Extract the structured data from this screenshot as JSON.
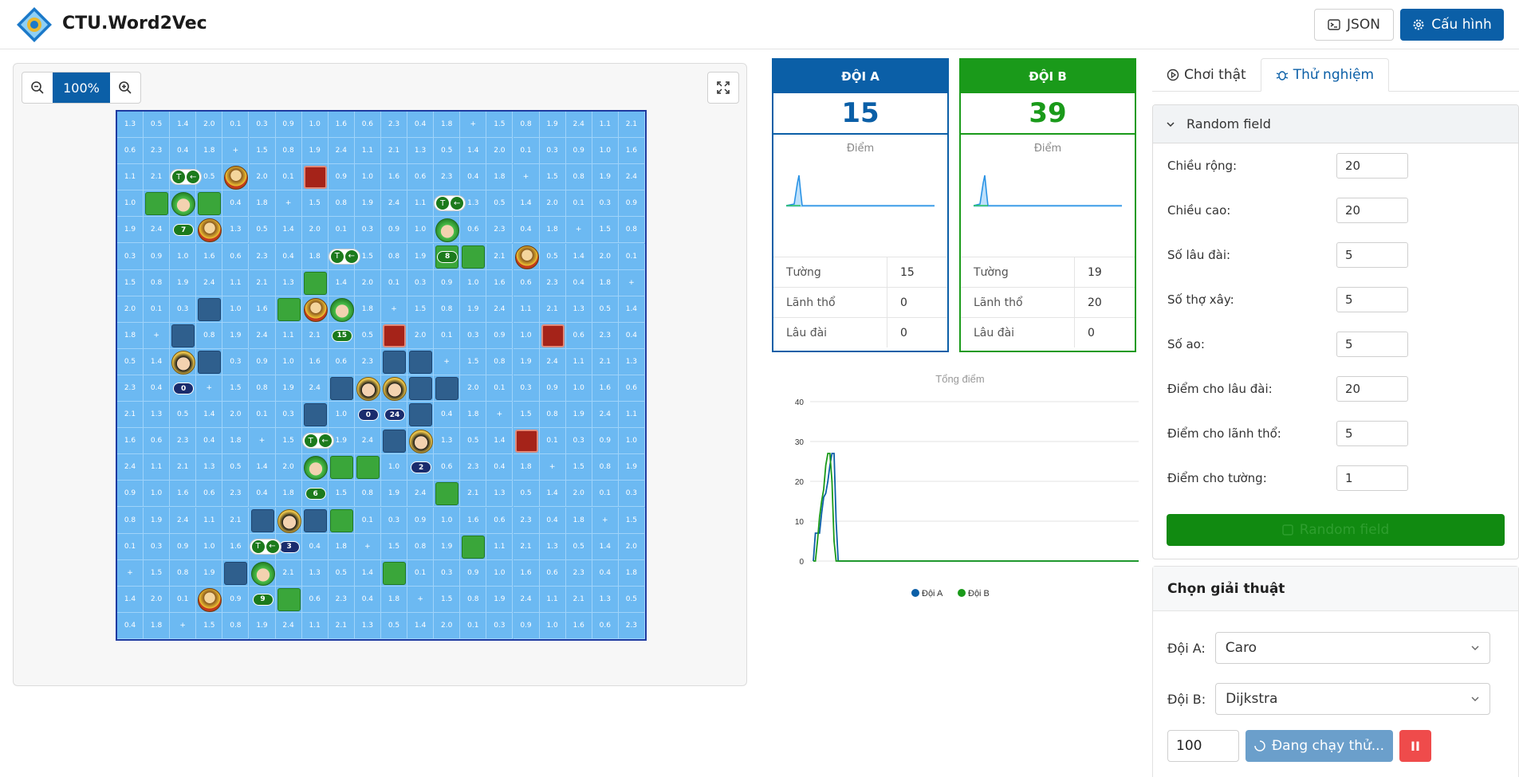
{
  "app": {
    "title": "CTU.Word2Vec"
  },
  "header": {
    "json_label": "JSON",
    "config_label": "Cấu hình"
  },
  "board": {
    "zoom": "100%",
    "size": 20,
    "walls_a": [
      [
        1,
        3
      ],
      [
        3,
        3
      ],
      [
        12,
        5
      ],
      [
        13,
        5
      ],
      [
        7,
        6
      ],
      [
        6,
        7
      ],
      [
        8,
        10
      ],
      [
        8,
        13
      ],
      [
        9,
        13
      ],
      [
        12,
        14
      ],
      [
        8,
        15
      ],
      [
        13,
        16
      ],
      [
        10,
        17
      ],
      [
        6,
        18
      ]
    ],
    "walls_b": [
      [
        3,
        7
      ],
      [
        2,
        8
      ],
      [
        3,
        9
      ],
      [
        10,
        9
      ],
      [
        11,
        9
      ],
      [
        8,
        10
      ],
      [
        11,
        10
      ],
      [
        12,
        10
      ],
      [
        7,
        11
      ],
      [
        11,
        11
      ],
      [
        10,
        12
      ],
      [
        5,
        15
      ],
      [
        7,
        15
      ],
      [
        4,
        17
      ]
    ],
    "castles": [
      [
        7,
        2
      ],
      [
        10,
        8
      ],
      [
        16,
        8
      ],
      [
        15,
        12
      ]
    ],
    "pirates": [
      [
        4,
        2
      ],
      [
        3,
        4
      ],
      [
        15,
        5
      ],
      [
        7,
        7
      ],
      [
        3,
        18
      ]
    ],
    "agents_a": [
      [
        2,
        3
      ],
      [
        12,
        4
      ],
      [
        8,
        7
      ],
      [
        7,
        13
      ],
      [
        5,
        17
      ]
    ],
    "agents_b": [
      [
        2,
        9
      ],
      [
        9,
        10
      ],
      [
        10,
        10
      ],
      [
        11,
        12
      ],
      [
        6,
        15
      ]
    ],
    "tags_a": [
      {
        "c": 2,
        "r": 4,
        "t": "7"
      },
      {
        "c": 12,
        "r": 5,
        "t": "8"
      },
      {
        "c": 8,
        "r": 8,
        "t": "15"
      },
      {
        "c": 7,
        "r": 14,
        "t": "6"
      },
      {
        "c": 5,
        "r": 18,
        "t": "9"
      }
    ],
    "tags_b": [
      {
        "c": 2,
        "r": 10,
        "t": "0"
      },
      {
        "c": 9,
        "r": 11,
        "t": "0"
      },
      {
        "c": 10,
        "r": 11,
        "t": "24"
      },
      {
        "c": 11,
        "r": 13,
        "t": "2"
      },
      {
        "c": 6,
        "r": 16,
        "t": "3"
      }
    ],
    "cell_values": [
      "1.3",
      "1.0",
      "1.5",
      "0.5",
      "1.6",
      "0.8",
      "1.4",
      "0.6",
      "1.9",
      "2.0",
      "2.3",
      "2.4",
      "0.1",
      "0.4",
      "1.1",
      "0.3",
      "1.8",
      "2.1",
      "0.9",
      "+"
    ]
  },
  "team_a": {
    "name": "ĐỘI A",
    "score": "15",
    "mini_title": "Điểm",
    "color": "#0b5fa7",
    "stats": [
      {
        "k": "Tường",
        "v": "15"
      },
      {
        "k": "Lãnh thổ",
        "v": "0"
      },
      {
        "k": "Lâu đài",
        "v": "0"
      }
    ]
  },
  "team_b": {
    "name": "ĐỘI B",
    "score": "39",
    "mini_title": "Điểm",
    "color": "#1a9a1a",
    "stats": [
      {
        "k": "Tường",
        "v": "19"
      },
      {
        "k": "Lãnh thổ",
        "v": "20"
      },
      {
        "k": "Lâu đài",
        "v": "0"
      }
    ]
  },
  "chart_data": {
    "type": "line",
    "title": "Tổng điểm",
    "yticks": [
      "40",
      "30",
      "20",
      "10",
      "0"
    ],
    "ylim": [
      0,
      40
    ],
    "series": [
      {
        "name": "Đội A",
        "color": "#0b5fa7",
        "values": [
          0,
          7,
          7,
          7,
          12,
          16,
          17,
          20,
          24,
          27,
          27,
          10,
          0,
          0,
          0,
          0,
          0,
          0,
          0,
          0
        ]
      },
      {
        "name": "Đội B",
        "color": "#1a9a1a",
        "values": [
          0,
          0,
          5,
          11,
          15,
          18,
          24,
          27,
          27,
          20,
          5,
          0,
          0,
          0,
          0,
          0,
          0,
          0,
          0,
          0
        ]
      }
    ]
  },
  "tabs": [
    {
      "label": "Chơi thật"
    },
    {
      "label": "Thử nghiệm"
    }
  ],
  "random": {
    "title": "Random field",
    "fields": [
      {
        "label": "Chiều rộng:",
        "value": "20"
      },
      {
        "label": "Chiều cao:",
        "value": "20"
      },
      {
        "label": "Số lâu đài:",
        "value": "5"
      },
      {
        "label": "Số thợ xây:",
        "value": "5"
      },
      {
        "label": "Số ao:",
        "value": "5"
      },
      {
        "label": "Điểm cho lâu đài:",
        "value": "20"
      },
      {
        "label": "Điểm cho lãnh thổ:",
        "value": "5"
      },
      {
        "label": "Điểm cho tường:",
        "value": "1"
      }
    ],
    "button": "Random field"
  },
  "algo": {
    "title": "Chọn giải thuật",
    "team_a_label": "Đội A:",
    "team_a_value": "Caro",
    "team_b_label": "Đội B:",
    "team_b_value": "Dijkstra",
    "run_count": "100",
    "run_label": "Đang chạy thử...",
    "stop_label": "II"
  }
}
